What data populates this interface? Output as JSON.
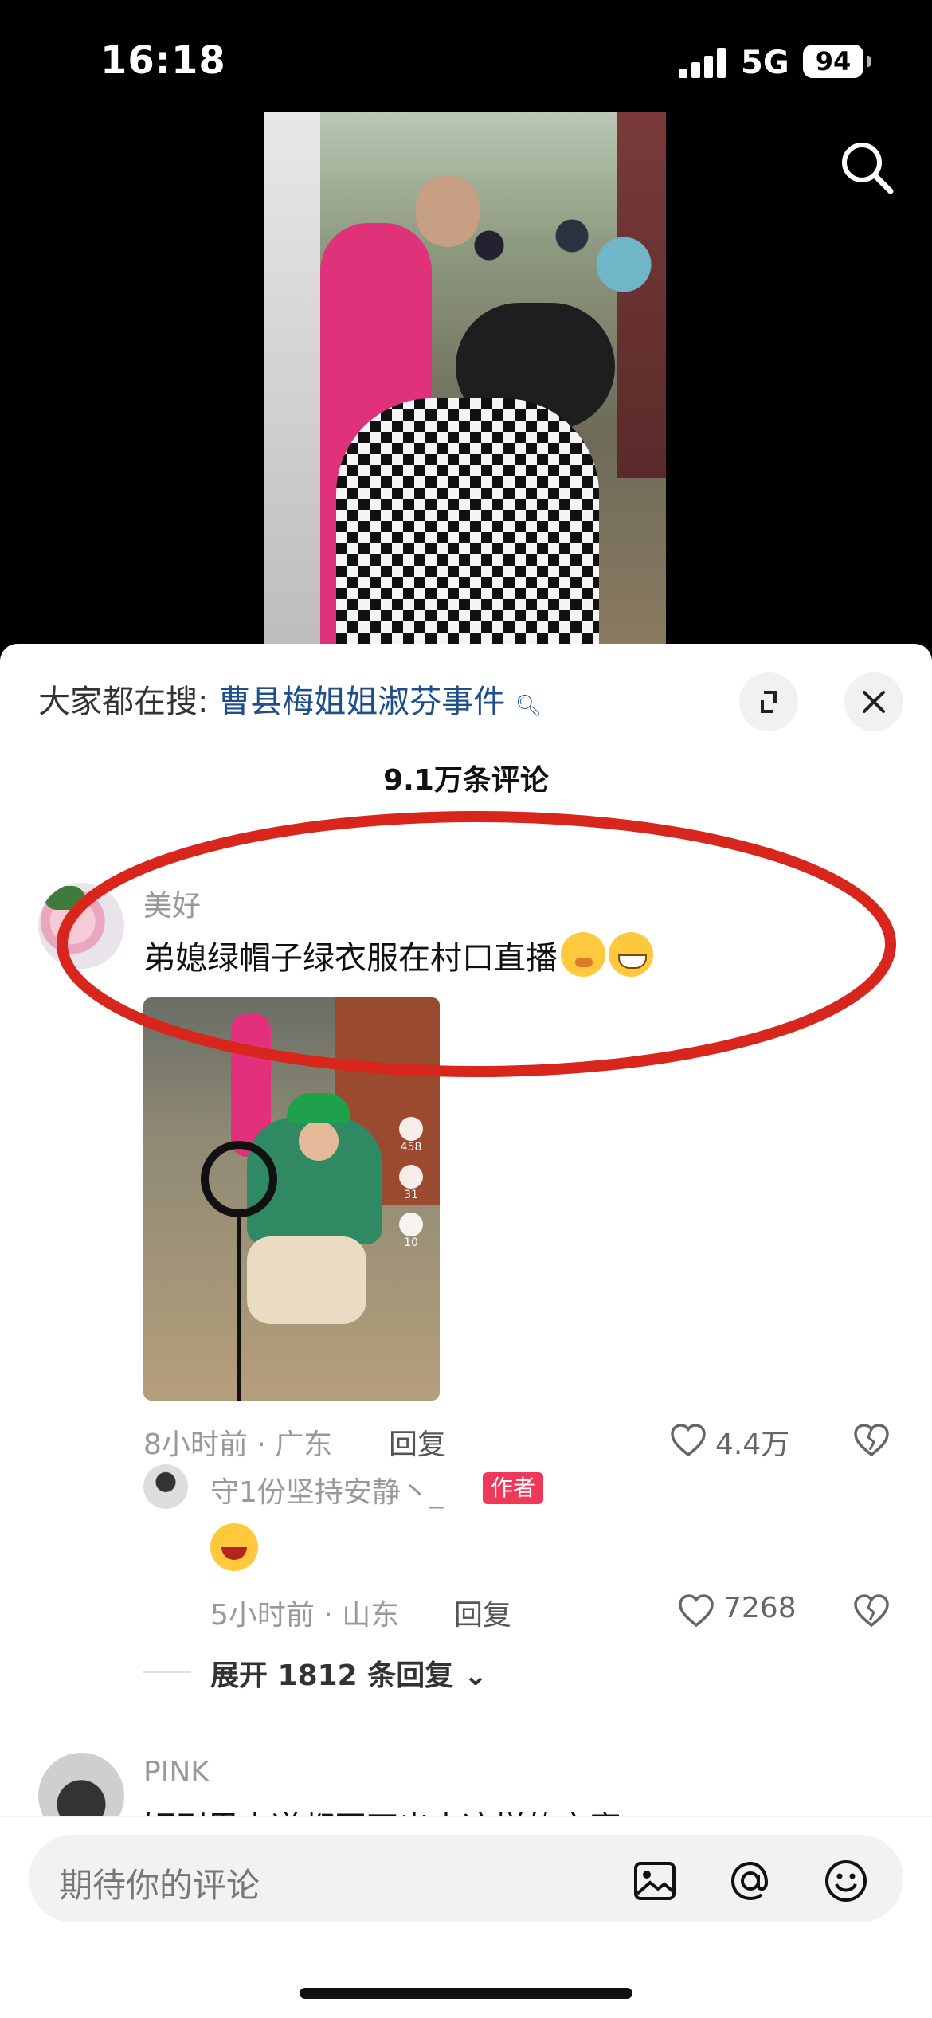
{
  "status": {
    "time": "16:18",
    "network": "5G",
    "battery": "94"
  },
  "sheet": {
    "hot_prefix": "大家都在搜:",
    "hot_link": "曹县梅姐姐淑芬事件",
    "comment_count": "9.1万条评论"
  },
  "comments": [
    {
      "username": "美好",
      "text": "弟媳绿帽子绿衣服在村口直播",
      "emojis": [
        "shy-emoji",
        "grin-emoji"
      ],
      "time_location": "8小时前 · 广东",
      "reply_label": "回复",
      "likes": "4.4万",
      "thumb_counts": {
        "likes": "458",
        "comments": "31",
        "favorites": "10"
      },
      "replies": [
        {
          "username": "守1份坚持安静丶_",
          "badge": "作者",
          "emoji": "laughing-emoji",
          "time_location": "5小时前 · 山东",
          "reply_label": "回复",
          "likes": "7268"
        }
      ],
      "expand_label": "展开 1812 条回复"
    },
    {
      "username": "PINK",
      "text": "短剧里大道都写不出来这样的文案"
    }
  ],
  "composer": {
    "placeholder": "期待你的评论"
  },
  "colors": {
    "accent_link": "#1f4e8c",
    "author_badge": "#f0385b",
    "annotation": "#d8261c"
  }
}
